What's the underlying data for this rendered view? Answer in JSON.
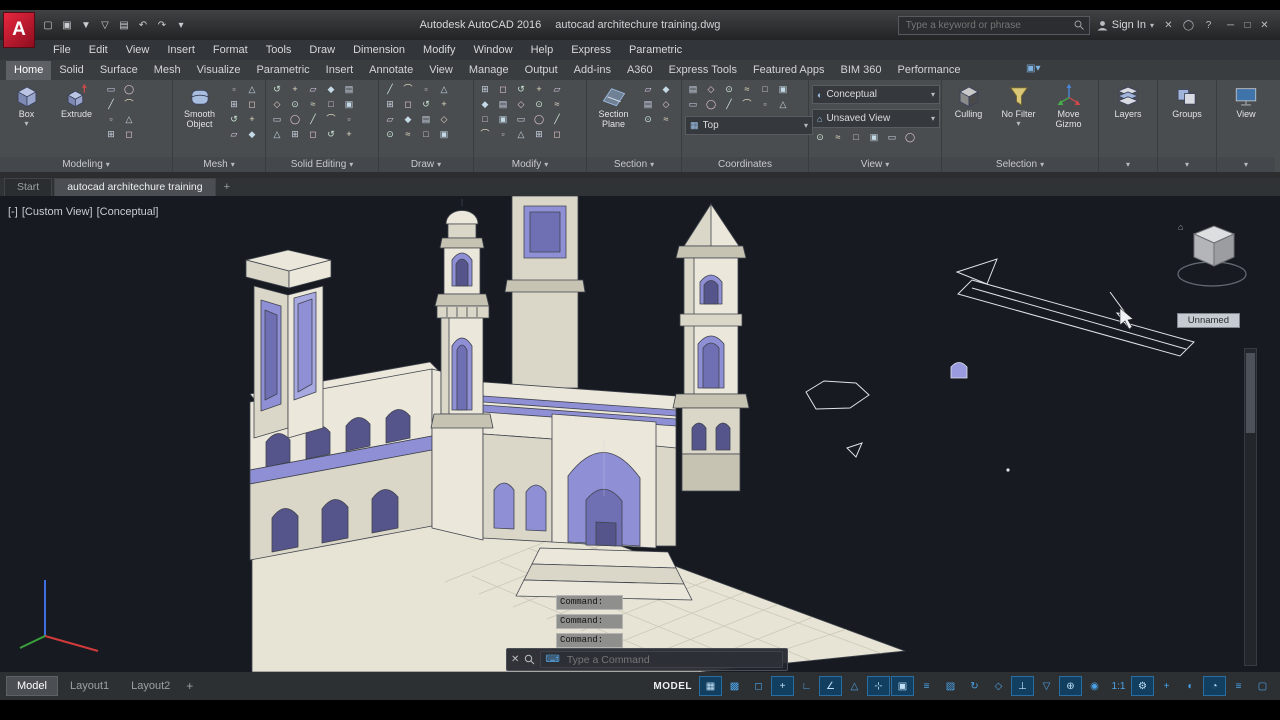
{
  "titlebar": {
    "logo_letter": "A",
    "quick_access": [
      {
        "name": "new-file-icon",
        "glyph": "▢"
      },
      {
        "name": "open-file-icon",
        "glyph": "▣"
      },
      {
        "name": "save-icon",
        "glyph": "▼"
      },
      {
        "name": "save-as-icon",
        "glyph": "▽"
      },
      {
        "name": "plot-icon",
        "glyph": "▤"
      },
      {
        "name": "undo-icon",
        "glyph": "↶"
      },
      {
        "name": "redo-icon",
        "glyph": "↷"
      },
      {
        "name": "quick-access-menu-icon",
        "glyph": "▾"
      }
    ],
    "app_title": "Autodesk AutoCAD 2016",
    "doc_title": "autocad architechure training.dwg",
    "search_placeholder": "Type a keyword or phrase",
    "sign_in_label": "Sign In",
    "right_icons": [
      {
        "name": "exchange-apps-icon",
        "glyph": "✕"
      },
      {
        "name": "autodesk-360-icon",
        "glyph": "◯"
      },
      {
        "name": "help-icon",
        "glyph": "?"
      }
    ],
    "window_controls": [
      {
        "name": "minimize-button",
        "glyph": "─"
      },
      {
        "name": "restore-button",
        "glyph": "□"
      },
      {
        "name": "close-button",
        "glyph": "✕"
      }
    ]
  },
  "menubar": {
    "items": [
      "File",
      "Edit",
      "View",
      "Insert",
      "Format",
      "Tools",
      "Draw",
      "Dimension",
      "Modify",
      "Window",
      "Help",
      "Express",
      "Parametric"
    ]
  },
  "ribbon": {
    "active_tab": "Home",
    "tabs": [
      "Home",
      "Solid",
      "Surface",
      "Mesh",
      "Visualize",
      "Parametric",
      "Insert",
      "Annotate",
      "View",
      "Manage",
      "Output",
      "Add-ins",
      "A360",
      "Express Tools",
      "Featured Apps",
      "BIM 360",
      "Performance"
    ],
    "toggle_glyph": "▣▾",
    "panels": {
      "modeling": {
        "label": "Modeling",
        "button1": "Box",
        "button2": "Extrude"
      },
      "mesh": {
        "label": "Mesh",
        "button1": "Smooth Object"
      },
      "solid_editing": {
        "label": "Solid Editing"
      },
      "draw": {
        "label": "Draw"
      },
      "modify": {
        "label": "Modify"
      },
      "section": {
        "label": "Section",
        "button1": "Section Plane"
      },
      "coordinates": {
        "label": "Coordinates",
        "view_select": "Top"
      },
      "view": {
        "label": "View",
        "visual_style": "Conceptual",
        "named_view": "Unsaved View"
      },
      "selection": {
        "label": "Selection",
        "button1": "Culling",
        "button2": "No Filter",
        "button3": "Move Gizmo"
      },
      "layers": {
        "label": "Layers"
      },
      "groups": {
        "label": "Groups"
      },
      "view_panel": {
        "label": "View"
      }
    }
  },
  "file_tabs": {
    "start_label": "Start",
    "doc_label": "autocad architechure training",
    "new_tab_label": "+"
  },
  "viewport": {
    "controls": [
      "[-]",
      "[Custom View]",
      "[Conceptual]"
    ],
    "viewcube_tooltip": "Unnamed",
    "command_history": [
      "Command:",
      "Command:",
      "Command:"
    ],
    "command_input": {
      "placeholder": "Type a Command"
    }
  },
  "statusbar": {
    "layout_tabs": [
      "Model",
      "Layout1",
      "Layout2"
    ],
    "active_layout": "Model",
    "new_layout_label": "+",
    "model_space_label": "MODEL",
    "icons": [
      {
        "name": "grid-display-icon",
        "glyph": "▦",
        "active": true
      },
      {
        "name": "snap-mode-icon",
        "glyph": "▩",
        "active": false
      },
      {
        "name": "infer-constraints-icon",
        "glyph": "◻",
        "active": false
      },
      {
        "name": "dynamic-input-icon",
        "glyph": "+",
        "active": true
      },
      {
        "name": "ortho-mode-icon",
        "glyph": "∟",
        "active": false
      },
      {
        "name": "polar-tracking-icon",
        "glyph": "∠",
        "active": true
      },
      {
        "name": "isometric-drafting-icon",
        "glyph": "△",
        "active": false
      },
      {
        "name": "object-snap-tracking-icon",
        "glyph": "⊹",
        "active": true
      },
      {
        "name": "object-snap-icon",
        "glyph": "▣",
        "active": true
      },
      {
        "name": "lineweight-icon",
        "glyph": "≡",
        "active": false
      },
      {
        "name": "transparency-icon",
        "glyph": "▨",
        "active": false
      },
      {
        "name": "selection-cycling-icon",
        "glyph": "↻",
        "active": false
      },
      {
        "name": "3d-object-snap-icon",
        "glyph": "◇",
        "active": false
      },
      {
        "name": "dynamic-ucs-icon",
        "glyph": "⊥",
        "active": true
      },
      {
        "name": "selection-filtering-icon",
        "glyph": "▽",
        "active": false
      },
      {
        "name": "gizmo-icon",
        "glyph": "⊕",
        "active": true
      },
      {
        "name": "annotation-visibility-icon",
        "glyph": "◉",
        "active": false
      },
      {
        "name": "annotation-scale-icon",
        "glyph": "1:1",
        "active": false
      },
      {
        "name": "workspace-switching-icon",
        "glyph": "⚙",
        "active": true
      },
      {
        "name": "annotation-monitor-icon",
        "glyph": "+",
        "active": false
      },
      {
        "name": "isolate-objects-icon",
        "glyph": "◐",
        "active": false
      },
      {
        "name": "graphics-performance-icon",
        "glyph": "◔",
        "active": true
      },
      {
        "name": "customization-menu-icon",
        "glyph": "≡",
        "active": false
      },
      {
        "name": "clean-screen-icon",
        "glyph": "▢",
        "active": false
      }
    ]
  },
  "colors": {
    "accent_blue": "#4aa3e8",
    "model_cream": "#ebe7da",
    "model_purple": "#8f8fd6",
    "viewport_bg": "#171b21",
    "status_active_bg": "#123f60"
  }
}
